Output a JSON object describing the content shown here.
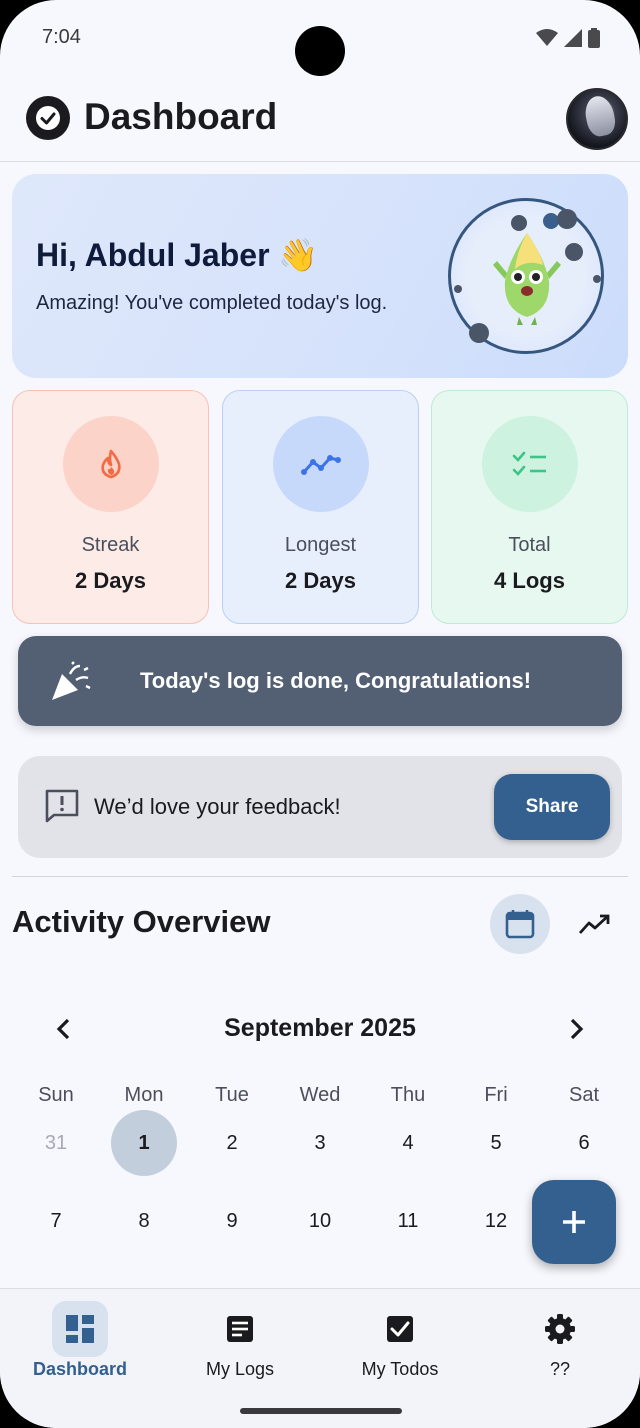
{
  "status_bar": {
    "time": "7:04"
  },
  "app_bar": {
    "title": "Dashboard"
  },
  "greeting": {
    "title": "Hi, Abdul Jaber 👋",
    "subtitle": "Amazing! You've completed today's log."
  },
  "stats": [
    {
      "label": "Streak",
      "value": "2 Days",
      "icon": "flame-icon",
      "accent": "#f26b45"
    },
    {
      "label": "Longest",
      "value": "2 Days",
      "icon": "trending-up-icon",
      "accent": "#3d73e8"
    },
    {
      "label": "Total",
      "value": "4 Logs",
      "icon": "checklist-icon",
      "accent": "#3dc487"
    }
  ],
  "congrats_banner": {
    "text": "Today's log is done, Congratulations!"
  },
  "feedback": {
    "text": "We’d love your feedback!",
    "button": "Share"
  },
  "activity": {
    "title": "Activity Overview",
    "calendar": {
      "month": "September 2025",
      "weekdays": [
        "Sun",
        "Mon",
        "Tue",
        "Wed",
        "Thu",
        "Fri",
        "Sat"
      ],
      "weeks": [
        [
          "31",
          "1",
          "2",
          "3",
          "4",
          "5",
          "6"
        ],
        [
          "7",
          "8",
          "9",
          "10",
          "11",
          "12",
          ""
        ]
      ],
      "selected_day": "1"
    }
  },
  "bottom_nav": [
    {
      "label": "Dashboard",
      "icon": "dashboard-icon",
      "active": true
    },
    {
      "label": "My Logs",
      "icon": "notes-icon",
      "active": false
    },
    {
      "label": "My Todos",
      "icon": "checkbox-icon",
      "active": false
    },
    {
      "label": "??",
      "icon": "settings-icon",
      "active": false
    }
  ],
  "colors": {
    "primary": "#33608f",
    "background": "#f7f8fd",
    "banner": "#535f73"
  }
}
